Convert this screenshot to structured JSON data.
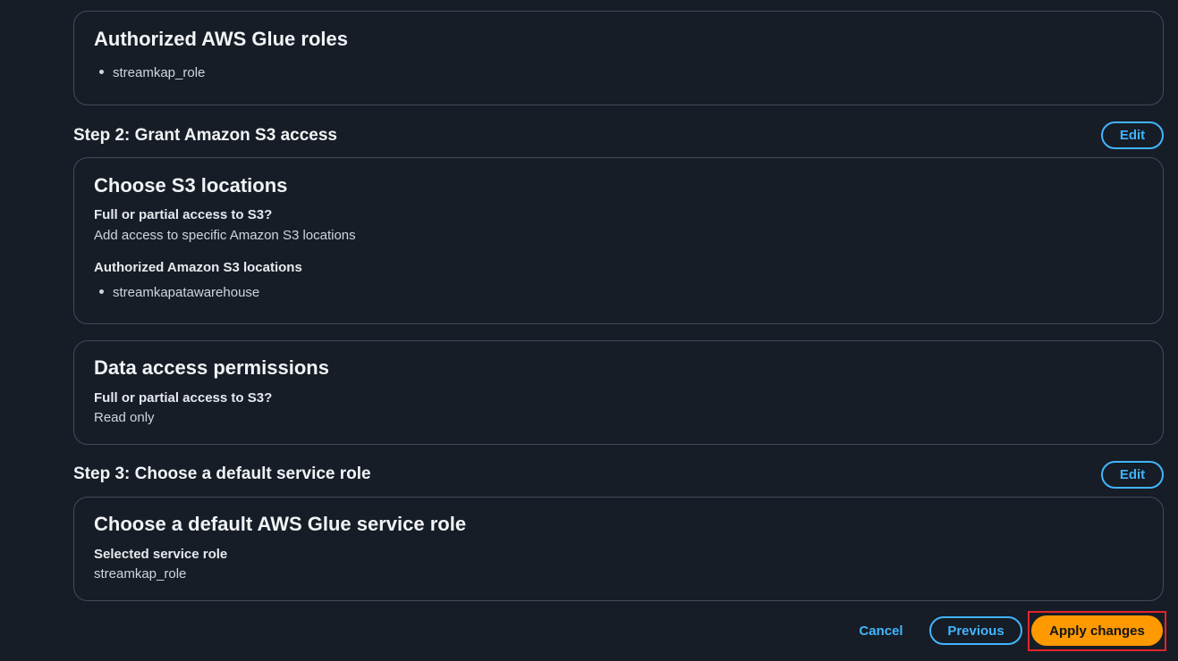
{
  "glue_roles_card": {
    "title": "Authorized AWS Glue roles",
    "roles": [
      "streamkap_role"
    ]
  },
  "step2": {
    "heading": "Step 2: Grant Amazon S3 access",
    "edit_label": "Edit",
    "s3_locations_card": {
      "title": "Choose S3 locations",
      "access_label": "Full or partial access to S3?",
      "access_value": "Add access to specific Amazon S3 locations",
      "locations_label": "Authorized Amazon S3 locations",
      "locations": [
        "streamkapatawarehouse"
      ]
    },
    "permissions_card": {
      "title": "Data access permissions",
      "access_label": "Full or partial access to S3?",
      "access_value": "Read only"
    }
  },
  "step3": {
    "heading": "Step 3: Choose a default service role",
    "edit_label": "Edit",
    "service_role_card": {
      "title": "Choose a default AWS Glue service role",
      "role_label": "Selected service role",
      "role_value": "streamkap_role"
    }
  },
  "footer": {
    "cancel_label": "Cancel",
    "previous_label": "Previous",
    "apply_label": "Apply changes"
  },
  "colors": {
    "background": "#161d26",
    "border": "#414d5c",
    "link_blue": "#42b4ff",
    "primary_orange": "#ff9900",
    "highlight_red": "#e3242b"
  }
}
